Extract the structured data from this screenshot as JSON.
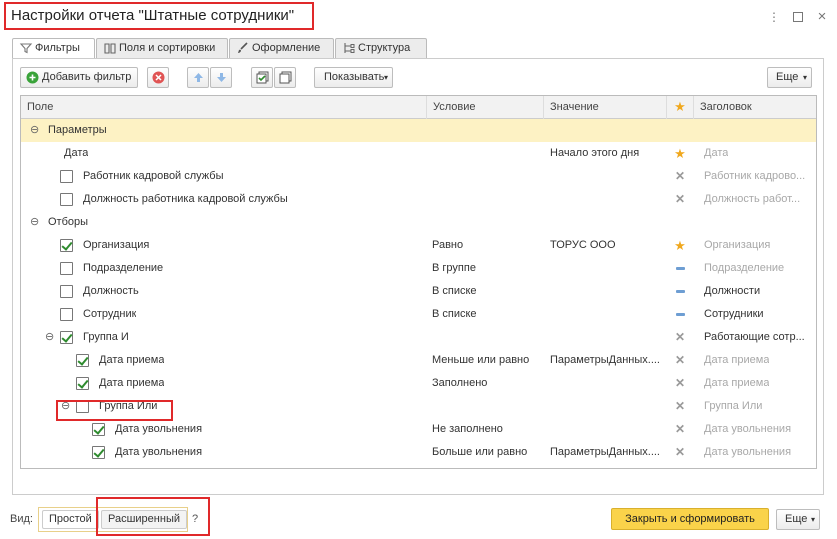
{
  "window": {
    "title": "Настройки отчета \"Штатные сотрудники\""
  },
  "tabs": [
    {
      "label": "Фильтры",
      "icon": "filter-icon"
    },
    {
      "label": "Поля и сортировки",
      "icon": "columns-icon"
    },
    {
      "label": "Оформление",
      "icon": "brush-icon"
    },
    {
      "label": "Структура",
      "icon": "structure-icon"
    }
  ],
  "toolbar": {
    "add_filter": "Добавить фильтр",
    "show": "Показывать",
    "more": "Еще"
  },
  "columns": {
    "field": "Поле",
    "condition": "Условие",
    "value": "Значение",
    "title": "Заголовок"
  },
  "rows": [
    {
      "field": "Параметры",
      "condition": "",
      "value": "",
      "use": "",
      "title": ""
    },
    {
      "field": "Дата",
      "condition": "",
      "value": "Начало этого дня",
      "use": "star",
      "title": "Дата"
    },
    {
      "field": "Работник кадровой службы",
      "condition": "",
      "value": "",
      "use": "x",
      "title": "Работник кадрово..."
    },
    {
      "field": "Должность работника кадровой службы",
      "condition": "",
      "value": "",
      "use": "x",
      "title": "Должность работ..."
    },
    {
      "field": "Отборы",
      "condition": "",
      "value": "",
      "use": "",
      "title": ""
    },
    {
      "field": "Организация",
      "condition": "Равно",
      "value": "ТОРУС ООО",
      "use": "star",
      "title": "Организация"
    },
    {
      "field": "Подразделение",
      "condition": "В группе",
      "value": "",
      "use": "dash",
      "title": "Подразделение"
    },
    {
      "field": "Должность",
      "condition": "В списке",
      "value": "",
      "use": "dash",
      "title": "Должности"
    },
    {
      "field": "Сотрудник",
      "condition": "В списке",
      "value": "",
      "use": "dash",
      "title": "Сотрудники"
    },
    {
      "field": "Группа И",
      "condition": "",
      "value": "",
      "use": "x",
      "title": "Работающие сотр..."
    },
    {
      "field": "Дата приема",
      "condition": "Меньше или равно",
      "value": "ПараметрыДанных....",
      "use": "x",
      "title": "Дата приема"
    },
    {
      "field": "Дата приема",
      "condition": "Заполнено",
      "value": "",
      "use": "x",
      "title": "Дата приема"
    },
    {
      "field": "Группа Или",
      "condition": "",
      "value": "",
      "use": "x",
      "title": "Группа Или"
    },
    {
      "field": "Дата увольнения",
      "condition": "Не заполнено",
      "value": "",
      "use": "x",
      "title": "Дата увольнения"
    },
    {
      "field": "Дата увольнения",
      "condition": "Больше или равно",
      "value": "ПараметрыДанных....",
      "use": "x",
      "title": "Дата увольнения"
    }
  ],
  "footer": {
    "view_label": "Вид:",
    "simple": "Простой",
    "advanced": "Расширенный",
    "help": "?",
    "close_and_build": "Закрыть и сформировать",
    "more": "Еще"
  },
  "colors": {
    "highlight_red": "#e0292a",
    "primary_yellow": "#fad34a",
    "selected_row": "#fdf2c4",
    "star": "#f0a81e"
  }
}
